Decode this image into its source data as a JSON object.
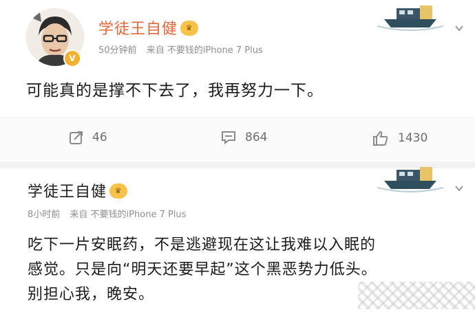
{
  "post1": {
    "username": "学徒王自健",
    "time": "50分钟前",
    "source": "来自 不要钱的iPhone 7 Plus",
    "text": "可能真的是撑不下去了，我再努力一下。",
    "actions": {
      "repost_count": "46",
      "comment_count": "864",
      "like_count": "1430"
    }
  },
  "post2": {
    "username": "学徒王自健",
    "time": "8小时前",
    "source": "来自 不要钱的iPhone 7 Plus",
    "text_lines": [
      "吃下一片安眠药，不是逃避现在这让我难以入眠的",
      "感觉。只是向“明天还要早起”这个黑恶势力低头。",
      "别担心我，晚安。"
    ]
  },
  "icons": [
    "boat-decoration-icon",
    "chevron-down-icon",
    "repost-icon",
    "comment-icon",
    "like-icon",
    "vip-badge-icon",
    "level-badge-icon"
  ],
  "colors": {
    "username_orange": "#e3683b",
    "meta_gray": "#8f8f8f",
    "badge_gold": "#f3b130"
  }
}
